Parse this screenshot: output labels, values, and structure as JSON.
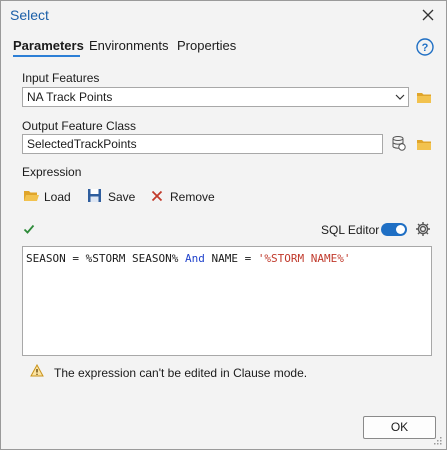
{
  "window": {
    "title": "Select",
    "close_icon": "close-icon"
  },
  "tabs": [
    {
      "label": "Parameters",
      "active": true
    },
    {
      "label": "Environments",
      "active": false
    },
    {
      "label": "Properties",
      "active": false
    }
  ],
  "help_icon": "help-icon",
  "params": {
    "input_features": {
      "label": "Input Features",
      "value": "NA Track Points"
    },
    "output_feature_class": {
      "label": "Output Feature Class",
      "value": "SelectedTrackPoints"
    },
    "expression": {
      "label": "Expression"
    }
  },
  "toolbar": {
    "load": "Load",
    "save": "Save",
    "remove": "Remove"
  },
  "sql_editor": {
    "label": "SQL Editor",
    "enabled": true
  },
  "expression_text": {
    "part1": "SEASON = %STORM SEASON% ",
    "kw": "And",
    "part2": " NAME = ",
    "str": "'%STORM NAME%'"
  },
  "warning": {
    "text": "The expression can't be edited in Clause mode."
  },
  "buttons": {
    "ok": "OK"
  },
  "colors": {
    "accent": "#1f6fc4",
    "title": "#1b5fa8",
    "folder": "#e0a52a",
    "remove": "#c23a2a"
  }
}
